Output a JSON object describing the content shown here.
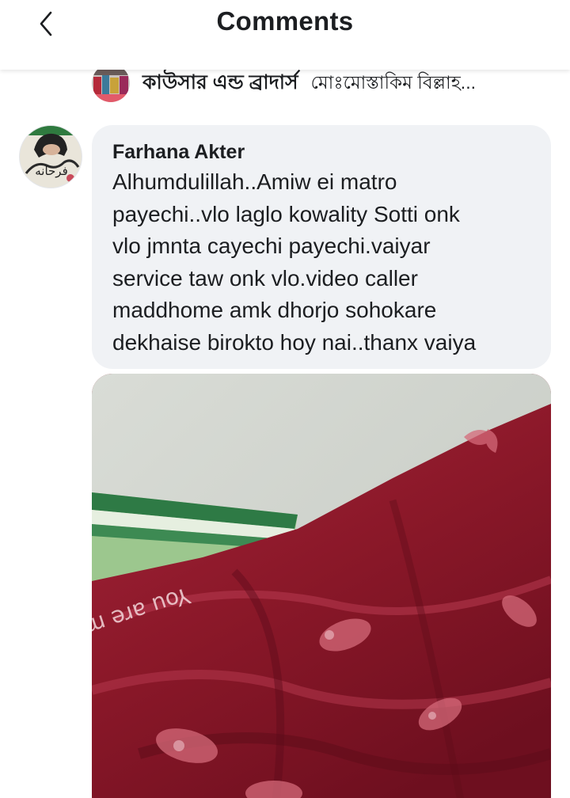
{
  "header": {
    "title": "Comments",
    "back_icon": "chevron-left-icon"
  },
  "previous_reply": {
    "author": "কাউসার এন্ড ব্রাদার্স",
    "text": "মোঃমোস্তাকিম বিল্লাহ..."
  },
  "comment": {
    "author": "Farhana Akter",
    "avatar_text": "فرحانه",
    "text": "Alhumdulillah..Amiw ei matro\npayechi..vlo laglo kowality Sotti onk\nvlo jmnta cayechi payechi.vaiyar\nservice taw onk vlo.video caller\nmaddhome amk dhorjo sohokare\ndekhaise birokto hoy nai..thanx vaiya",
    "photo": {
      "fabric_print": "You are my woman"
    }
  },
  "colors": {
    "bubble_bg": "#f0f2f5",
    "text": "#1c1e21",
    "blanket": "#8a1a2a"
  }
}
